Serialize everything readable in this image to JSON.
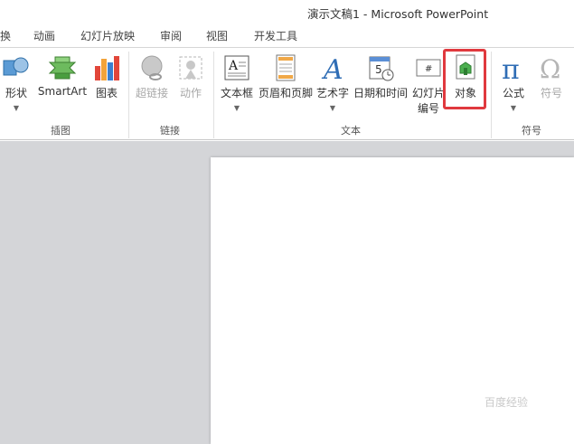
{
  "window": {
    "title": "演示文稿1  -  Microsoft PowerPoint"
  },
  "tabs": [
    {
      "label": "换"
    },
    {
      "label": "动画"
    },
    {
      "label": "幻灯片放映"
    },
    {
      "label": "审阅"
    },
    {
      "label": "视图"
    },
    {
      "label": "开发工具"
    }
  ],
  "ribbon": {
    "groups": {
      "illustrations": "插图",
      "links": "链接",
      "text": "文本",
      "symbols": "符号"
    },
    "buttons": {
      "shapes": "形状",
      "smartart": "SmartArt",
      "chart": "图表",
      "hyperlink": "超链接",
      "action": "动作",
      "textbox": "文本框",
      "header_footer": "页眉和页脚",
      "wordart": "艺术字",
      "datetime": "日期和时间",
      "slide_number_line1": "幻灯片",
      "slide_number_line2": "编号",
      "object": "对象",
      "equation": "公式",
      "symbol": "符号"
    }
  },
  "watermark": "百度经验",
  "colors": {
    "highlight": "#e0393e",
    "workspace": "#d4d5d8",
    "ribbon_border": "#c8c8c8"
  }
}
